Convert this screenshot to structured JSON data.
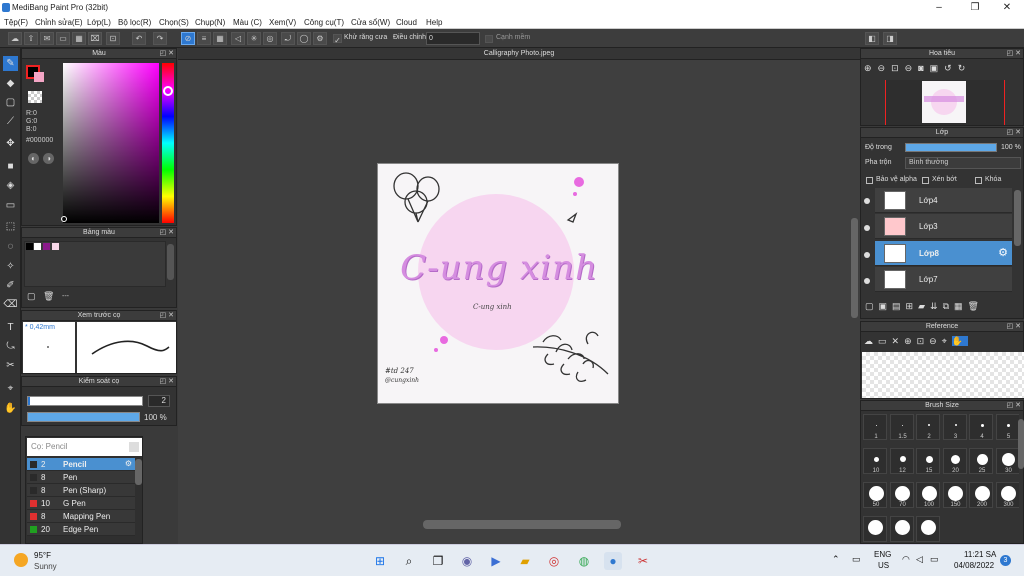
{
  "app": {
    "title": "MediBang Paint Pro (32bit)"
  },
  "menu": [
    "Tệp(F)",
    "Chỉnh sửa(E)",
    "Lớp(L)",
    "Bộ lọc(R)",
    "Chọn(S)",
    "Chụp(N)",
    "Màu (C)",
    "Xem(V)",
    "Công cụ(T)",
    "Cửa sổ(W)",
    "Cloud",
    "Help"
  ],
  "toolbar": {
    "antialias_label": "Khử răng cưa",
    "adjust_label": "Điều chỉnh",
    "adjust_value": "0",
    "edge_label": "Cạnh mềm"
  },
  "color_panel": {
    "title": "Màu",
    "r": "R:0",
    "g": "G:0",
    "b": "B:0",
    "hex": "#000000"
  },
  "palette_panel": {
    "title": "Bảng màu",
    "extra": "---"
  },
  "brush_preview": {
    "title": "Xem trước cọ",
    "size": "* 0,42mm"
  },
  "brush_control": {
    "title": "Kiểm soát cọ",
    "size_value": "2",
    "opacity_value": "100 %"
  },
  "brush_list": {
    "header": "Cọ: Pencil",
    "items": [
      {
        "size": "2",
        "name": "Pencil",
        "color": "#2a2a2a"
      },
      {
        "size": "8",
        "name": "Pen",
        "color": "#2a2a2a"
      },
      {
        "size": "8",
        "name": "Pen (Sharp)",
        "color": "#2a2a2a"
      },
      {
        "size": "10",
        "name": "G Pen",
        "color": "#e03030"
      },
      {
        "size": "8",
        "name": "Mapping Pen",
        "color": "#e03030"
      },
      {
        "size": "20",
        "name": "Edge Pen",
        "color": "#20a020"
      }
    ]
  },
  "document": {
    "tab": "Calligraphy Photo.jpeg",
    "title_text": "C-ung xinh",
    "subtitle_text": "C-ung xinh",
    "tag1": "#td 247",
    "tag2": "@cungxinh"
  },
  "navigator": {
    "title": "Hoa tiêu"
  },
  "layer_panel": {
    "title": "Lớp",
    "opacity_label": "Độ trong",
    "opacity_value": "100 %",
    "blend_label": "Pha trộn",
    "blend_value": "Bình thường",
    "protect_alpha": "Bảo vệ alpha",
    "clip": "Xén bớt",
    "lock": "Khóa",
    "layers": [
      {
        "name": "Lớp4",
        "selected": false,
        "thumb": "#ffffff"
      },
      {
        "name": "Lớp3",
        "selected": false,
        "thumb": "#ffc8cc"
      },
      {
        "name": "Lớp8",
        "selected": true,
        "thumb": "#ffffff"
      },
      {
        "name": "Lớp7",
        "selected": false,
        "thumb": "#ffffff"
      }
    ]
  },
  "reference": {
    "title": "Reference"
  },
  "brush_size": {
    "title": "Brush Size",
    "sizes": [
      {
        "label": "1",
        "d": 1
      },
      {
        "label": "1.5",
        "d": 1
      },
      {
        "label": "2",
        "d": 2
      },
      {
        "label": "3",
        "d": 2
      },
      {
        "label": "4",
        "d": 3
      },
      {
        "label": "5",
        "d": 3
      },
      {
        "label": "10",
        "d": 5
      },
      {
        "label": "12",
        "d": 6
      },
      {
        "label": "15",
        "d": 7
      },
      {
        "label": "20",
        "d": 9
      },
      {
        "label": "25",
        "d": 11
      },
      {
        "label": "30",
        "d": 13
      },
      {
        "label": "50",
        "d": 15
      },
      {
        "label": "70",
        "d": 15
      },
      {
        "label": "100",
        "d": 15
      },
      {
        "label": "150",
        "d": 15
      },
      {
        "label": "200",
        "d": 15
      },
      {
        "label": "300",
        "d": 15
      }
    ]
  },
  "taskbar": {
    "temp": "95°F",
    "weather": "Sunny",
    "lang1": "ENG",
    "lang2": "US",
    "time": "11:21 SA",
    "date": "04/08/2022",
    "badge": "3"
  },
  "colors": {
    "accent": "#2e78d0",
    "selected_layer": "#4a90d0"
  }
}
